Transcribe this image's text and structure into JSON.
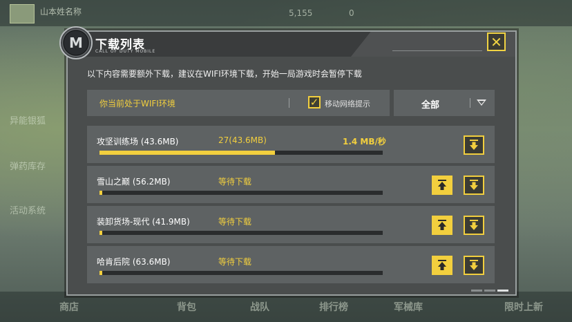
{
  "background": {
    "player_name": "山本姓名称",
    "currency_a": "5,155",
    "currency_b": "0",
    "left_labels": [
      "异能银狐",
      "弹药库存",
      "活动系统"
    ],
    "bottom_tabs": [
      "商店",
      "背包",
      "战队",
      "排行榜",
      "军械库",
      "限时上新"
    ]
  },
  "dialog": {
    "logo_text": "M",
    "title": "下载列表",
    "subtitle": "CALL OF DUTY MOBILE",
    "close_icon": "close-icon",
    "notice": "以下内容需要额外下载，建议在WIFI环境下载，开始一局游戏时会暂停下载",
    "filter": {
      "status_text": "你当前处于WIFI环境",
      "mobile_prompt_checked": true,
      "mobile_prompt_label": "移动网络提示"
    },
    "dropdown": {
      "selected": "全部"
    },
    "items": [
      {
        "name": "攻坚训练场 (43.6MB)",
        "status": "27(43.6MB)",
        "speed": "1.4 MB/秒",
        "progress": 0.62,
        "show_top_button": false
      },
      {
        "name": "雪山之巅 (56.2MB)",
        "status": "等待下载",
        "speed": "",
        "progress": 0.01,
        "show_top_button": true
      },
      {
        "name": "装卸货场-现代 (41.9MB)",
        "status": "等待下载",
        "speed": "",
        "progress": 0.01,
        "show_top_button": true
      },
      {
        "name": "哈肯后院 (63.6MB)",
        "status": "等待下载",
        "speed": "",
        "progress": 0.01,
        "show_top_button": true
      }
    ]
  },
  "colors": {
    "accent": "#f2cf3e",
    "panel": "#4a4d4d",
    "row": "#5e6263"
  }
}
